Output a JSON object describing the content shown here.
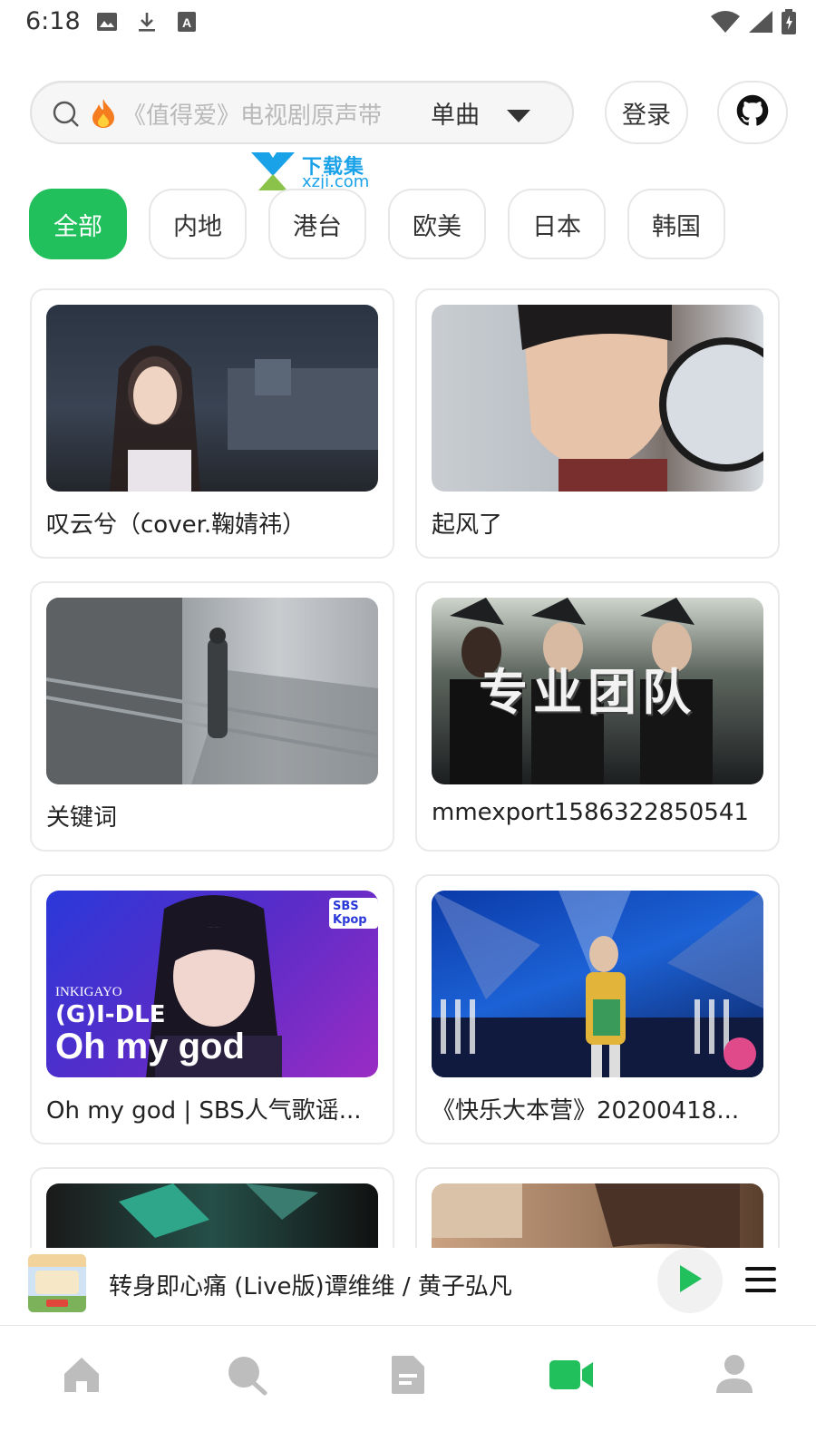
{
  "status_bar": {
    "time": "6:18",
    "left_icons": [
      "image-icon",
      "download-icon",
      "text-a-icon"
    ],
    "right_icons": [
      "wifi-icon",
      "signal-icon",
      "battery-icon"
    ]
  },
  "search": {
    "placeholder": "《值得爱》电视剧原声带",
    "type_label": "单曲",
    "hot_icon": "fire-icon"
  },
  "header_buttons": {
    "login_label": "登录",
    "github_icon": "github-icon"
  },
  "watermark": {
    "title": "下载集",
    "url": "xzji.com"
  },
  "categories": {
    "items": [
      "全部",
      "内地",
      "港台",
      "欧美",
      "日本",
      "韩国"
    ],
    "active_index": 0
  },
  "videos": [
    {
      "title": "叹云兮（cover.鞠婧祎）"
    },
    {
      "title": "起风了"
    },
    {
      "title": "关键词"
    },
    {
      "title": "mmexport1586322850541",
      "overlay": "专业团队"
    },
    {
      "title": "Oh my god | SBS人气歌谣...",
      "overlay_small": "INKIGAYO",
      "overlay_mid": "(G)I-DLE",
      "overlay_big": "Oh my god",
      "badge": "SBS Kpop"
    },
    {
      "title": "《快乐大本营》20200418..."
    },
    {
      "title": ""
    },
    {
      "title": ""
    }
  ],
  "player": {
    "track": "转身即心痛 (Live版)谭维维 / 黄子弘凡",
    "play_icon": "play-icon",
    "menu_icon": "menu-icon"
  },
  "tabbar": {
    "tabs": [
      "home-icon",
      "search-icon",
      "document-icon",
      "video-icon",
      "user-icon"
    ],
    "active_index": 3
  },
  "colors": {
    "accent": "#22c05c",
    "watermark": "#1aa2e8"
  }
}
